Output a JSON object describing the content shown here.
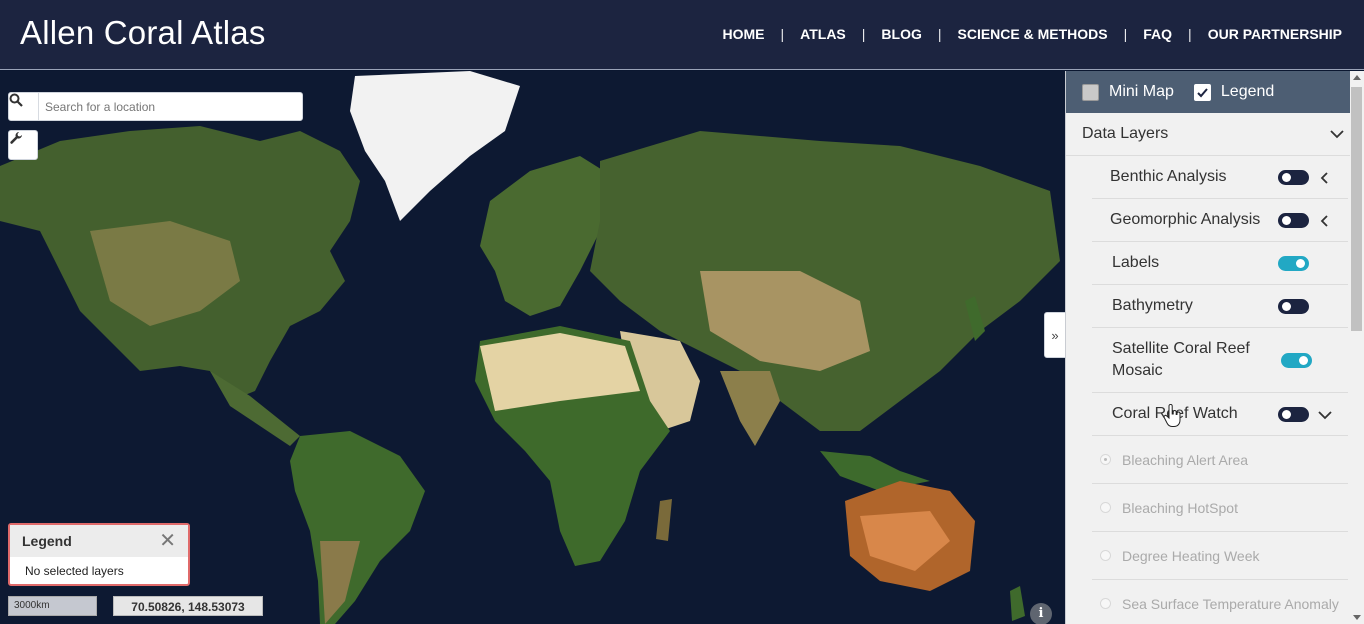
{
  "header": {
    "brand": "Allen Coral Atlas",
    "nav": [
      {
        "label": "HOME"
      },
      {
        "label": "ATLAS"
      },
      {
        "label": "BLOG"
      },
      {
        "label": "SCIENCE & METHODS"
      },
      {
        "label": "FAQ"
      },
      {
        "label": "OUR PARTNERSHIP"
      }
    ],
    "separator": "|"
  },
  "map": {
    "search_placeholder": "Search for a location",
    "legend": {
      "title": "Legend",
      "close_glyph": "✕",
      "body": "No selected layers"
    },
    "scale_label": "3000km",
    "coordinates": "70.50826, 148.53073",
    "info_glyph": "i",
    "collapse_glyph": "»"
  },
  "panel": {
    "mini_map": {
      "label": "Mini Map",
      "checked": false
    },
    "legend_toggle": {
      "label": "Legend",
      "checked": true
    },
    "section_title": "Data Layers",
    "layers": [
      {
        "label": "Benthic Analysis",
        "on": false,
        "chevron": "left"
      },
      {
        "label": "Geomorphic Analysis",
        "on": false,
        "chevron": "left"
      },
      {
        "label": "Labels",
        "on": true
      },
      {
        "label": "Bathymetry",
        "on": false
      },
      {
        "label": "Satellite Coral Reef Mosaic",
        "on": true
      },
      {
        "label": "Coral Reef Watch",
        "on": false,
        "chevron": "down"
      }
    ],
    "sublayers": [
      {
        "label": "Bleaching Alert Area",
        "selected": true
      },
      {
        "label": "Bleaching HotSpot",
        "selected": false
      },
      {
        "label": "Degree Heating Week",
        "selected": false
      },
      {
        "label": "Sea Surface Temperature Anomaly",
        "selected": false
      }
    ]
  },
  "colors": {
    "header_bg": "#1c2440",
    "panel_top_bg": "#4d5e73",
    "toggle_on": "#22a8c4",
    "toggle_off": "#1c2440",
    "ocean": "#0d1932",
    "legend_border": "#e06a6a"
  }
}
